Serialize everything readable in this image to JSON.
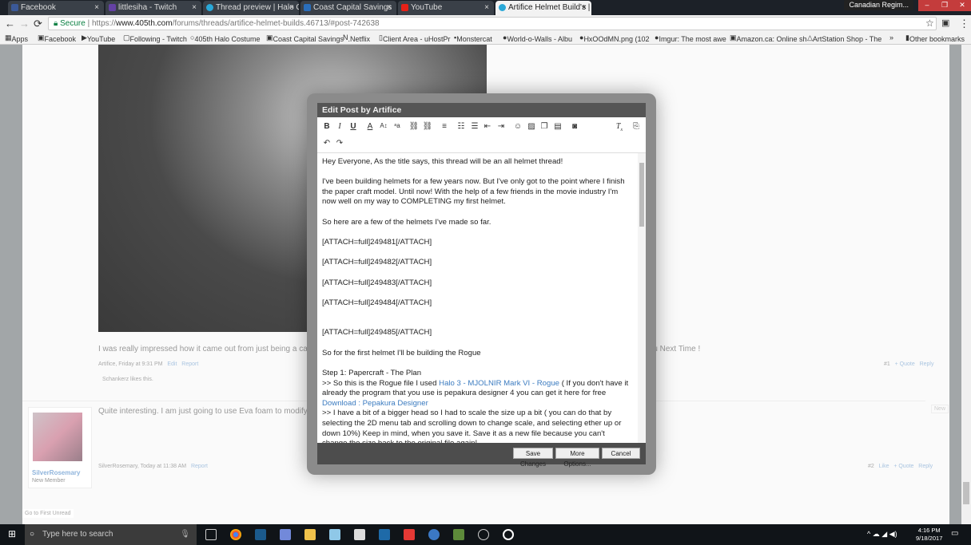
{
  "browser": {
    "tabs": [
      {
        "label": "Facebook",
        "color": "#3b5998"
      },
      {
        "label": "littlesiha - Twitch",
        "color": "#6441a4"
      },
      {
        "label": "Thread preview | Halo Co",
        "color": "#29a8d8"
      },
      {
        "label": "Coast Capital Savings",
        "color": "#2a6ebb"
      },
      {
        "label": "YouTube",
        "color": "#e62117"
      },
      {
        "label": "Artifice Helmet Build's | ",
        "color": "#29a8d8"
      }
    ],
    "profile": "Canadian Regim...",
    "secure": "Secure",
    "url_scheme": "https://",
    "url_host": "www.405th.com",
    "url_path": "/forums/threads/artifice-helmet-builds.46713/#post-742638",
    "bookmarks": [
      "Apps",
      "Facebook",
      "YouTube",
      "Following - Twitch",
      "405th Halo Costume",
      "Coast Capital Savings",
      ".Netflix",
      "Client Area - uHostPr",
      "Monstercat",
      "World-o-Walls - Albu",
      "HxOOdMN.png (102",
      "Imgur: The most awe",
      "Amazon.ca: Online sh",
      "ArtStation Shop - The",
      "»",
      "Other bookmarks"
    ]
  },
  "thread": {
    "post1_text": "I was really impressed how it came out from just being a cardstock",
    "post1_tail": "You Next Time !",
    "post1_meta": "Artifice, Friday at 9:31 PM",
    "edit": "Edit",
    "report": "Report",
    "likes_user": "Schankerz",
    "likes_text": " likes this.",
    "post1_num": "#1",
    "quote": "+ Quote",
    "reply": "Reply",
    "like": "Like",
    "post2_text": "Quite interesting. I am just going to use Eva foam to modify a helm",
    "post2_user": "SilverRosemary",
    "post2_role": "New Member",
    "post2_meta": "SilverRosemary, Today at 11:38 AM",
    "post2_num": "#2",
    "new_badge": "New",
    "first_unread": "Go to First Unread"
  },
  "modal": {
    "title": "Edit Post by Artifice",
    "lines": [
      "Hey Everyone, As the title says, this thread will be an all helmet thread!",
      "I've been building helmets for a few years now. But I've only got to the point where I finish the paper craft model. Until now! With the help of a few friends in the movie industry I'm now well on my way to COMPLETING my first helmet.",
      "So here are a few of the helmets I've made so far.",
      "[ATTACH=full]249481[/ATTACH]",
      "[ATTACH=full]249482[/ATTACH]",
      "[ATTACH=full]249483[/ATTACH]",
      "[ATTACH=full]249484[/ATTACH]",
      "[ATTACH=full]249485[/ATTACH]",
      "So for the first helmet I'll be building the Rogue"
    ],
    "step_title": "Step 1: Papercraft - The Plan",
    "step_a": ">> So this is the Rogue file I used ",
    "link1": "Halo 3 - MJOLNIR Mark VI - Rogue",
    "step_b": " ( If you don't have it already the program that you use is pepakura designer 4 you can get it here for free",
    "link2": "Download : Pepakura Designer",
    "step_c": ">> I have a bit of a bigger head so I had to scale the size up a bit ( you can do that by selecting the 2D menu tab and scrolling down to change scale, and selecting ether up or down 10%) Keep in mind, when you save it. Save it as a new file because you can't change the size back to the original file again!",
    "save": "Save Changes",
    "more": "More Options...",
    "cancel": "Cancel"
  },
  "taskbar": {
    "search_placeholder": "Type here to search",
    "time": "4:16 PM",
    "date": "9/18/2017"
  }
}
